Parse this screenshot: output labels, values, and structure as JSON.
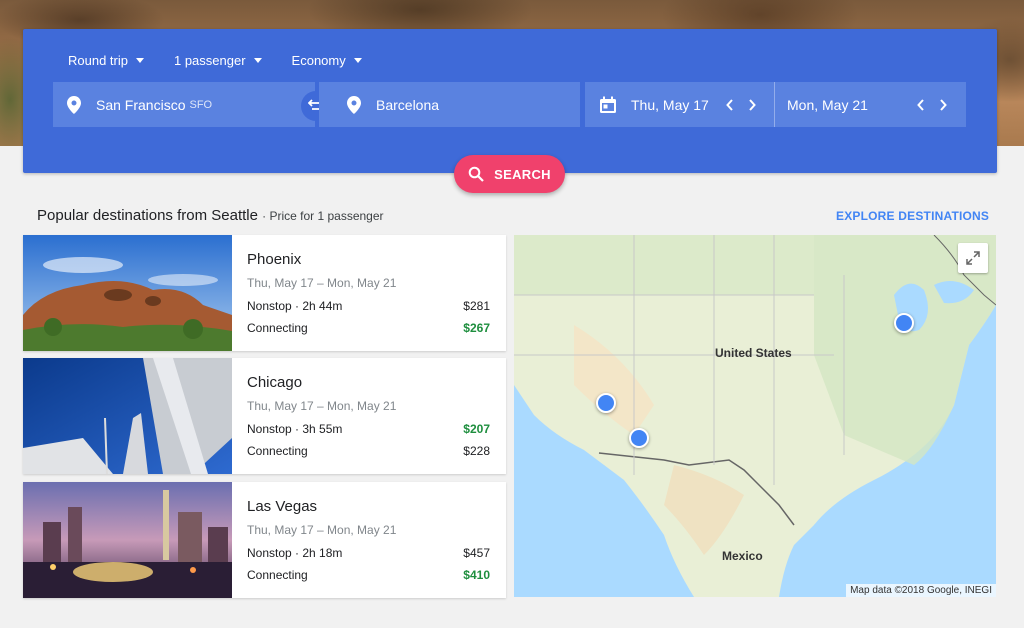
{
  "search": {
    "trip_type": "Round trip",
    "passengers": "1 passenger",
    "cabin": "Economy",
    "origin": "San Francisco",
    "origin_code": "SFO",
    "destination": "Barcelona",
    "depart_date": "Thu, May 17",
    "return_date": "Mon, May 21",
    "search_label": "SEARCH"
  },
  "section": {
    "title": "Popular destinations from Seattle",
    "subtitle": "· Price for 1 passenger",
    "explore_label": "EXPLORE DESTINATIONS"
  },
  "destinations": [
    {
      "city": "Phoenix",
      "dates": "Thu, May 17 – Mon, May 21",
      "nonstop": "Nonstop · 2h 44m",
      "nonstop_price": "$281",
      "connecting": "Connecting",
      "connecting_price": "$267"
    },
    {
      "city": "Chicago",
      "dates": "Thu, May 17 – Mon, May 21",
      "nonstop": "Nonstop · 3h 55m",
      "nonstop_price": "$207",
      "connecting": "Connecting",
      "connecting_price": "$228"
    },
    {
      "city": "Las Vegas",
      "dates": "Thu, May 17 – Mon, May 21",
      "nonstop": "Nonstop · 2h 18m",
      "nonstop_price": "$457",
      "connecting": "Connecting",
      "connecting_price": "$410"
    }
  ],
  "map": {
    "label_us": "United States",
    "label_mx": "Mexico",
    "credit": "Map data ©2018 Google, INEGI"
  },
  "colors": {
    "accent": "#3f6ad8",
    "search_button": "#f0416c",
    "best_price": "#1e8e3e",
    "link": "#4285f4"
  }
}
